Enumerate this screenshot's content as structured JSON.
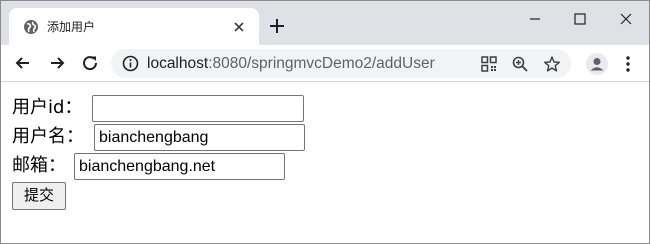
{
  "browser": {
    "tab": {
      "title": "添加用户",
      "favicon": "globe-icon"
    },
    "address_bar": {
      "host": "localhost",
      "path": ":8080/springmvcDemo2/addUser"
    }
  },
  "form": {
    "user_id": {
      "label": "用户id：",
      "value": ""
    },
    "user_name": {
      "label": "用户名：",
      "value": "bianchengbang"
    },
    "email": {
      "label": "邮箱：",
      "value": "bianchengbang.net"
    },
    "submit_label": "提交"
  }
}
